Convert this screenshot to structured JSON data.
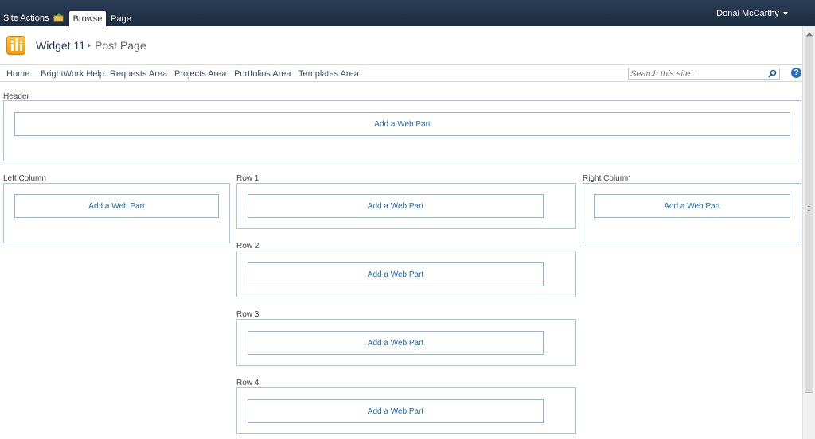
{
  "ribbon": {
    "site_actions": "Site Actions",
    "tabs": [
      {
        "label": "Browse"
      },
      {
        "label": "Page"
      }
    ],
    "user": "Donal McCarthy"
  },
  "title": {
    "site": "Widget 11",
    "page": "Post Page"
  },
  "nav": {
    "items": [
      "Home",
      "BrightWork Help",
      "Requests Area",
      "Projects Area",
      "Portfolios Area",
      "Templates Area"
    ]
  },
  "search": {
    "placeholder": "Search this site..."
  },
  "zones": {
    "header": {
      "label": "Header",
      "button": "Add a Web Part"
    },
    "left": {
      "label": "Left Column",
      "button": "Add a Web Part"
    },
    "right": {
      "label": "Right Column",
      "button": "Add a Web Part"
    },
    "rows": [
      {
        "label": "Row 1",
        "button": "Add a Web Part"
      },
      {
        "label": "Row 2",
        "button": "Add a Web Part"
      },
      {
        "label": "Row 3",
        "button": "Add a Web Part"
      },
      {
        "label": "Row 4",
        "button": "Add a Web Part"
      }
    ]
  },
  "icons": {
    "help": "?"
  },
  "colors": {
    "ribbon": "#1d2c40",
    "zone_border": "#a8c7e6",
    "link": "#1c6bb5"
  }
}
